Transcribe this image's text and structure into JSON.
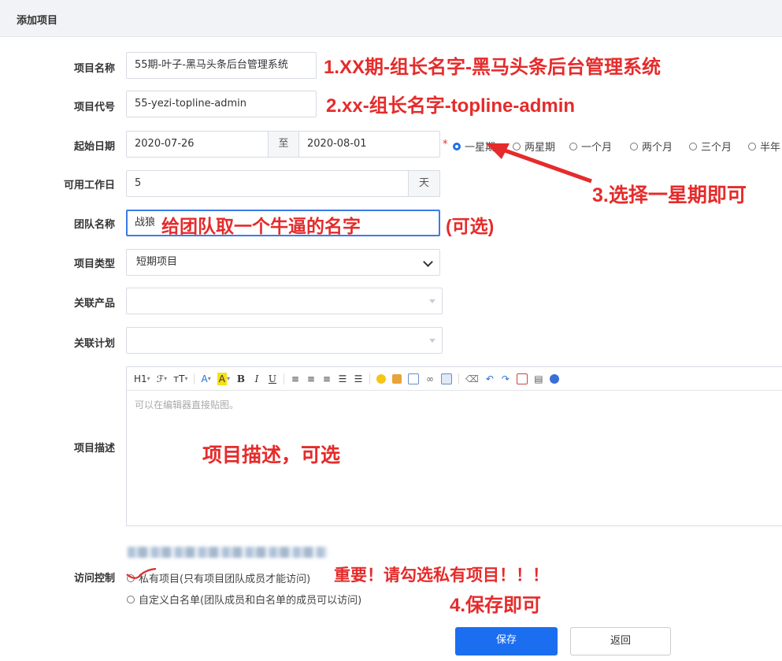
{
  "header": {
    "title": "添加项目"
  },
  "form": {
    "name_label": "项目名称",
    "name_value": "55期-叶子-黑马头条后台管理系统",
    "code_label": "项目代号",
    "code_value": "55-yezi-topline-admin",
    "date_label": "起始日期",
    "start_date": "2020-07-26",
    "to_text": "至",
    "end_date": "2020-08-01",
    "required_mark": "*",
    "durations": [
      "一星期",
      "两星期",
      "一个月",
      "两个月",
      "三个月",
      "半年"
    ],
    "selected_duration": "一星期",
    "workdays_label": "可用工作日",
    "workdays_value": "5",
    "workdays_unit": "天",
    "team_label": "团队名称",
    "team_value": "战狼",
    "type_label": "项目类型",
    "type_value": "短期项目",
    "product_label": "关联产品",
    "plan_label": "关联计划",
    "desc_label": "项目描述",
    "editor_placeholder": "可以在编辑器直接贴图。",
    "access_label": "访问控制",
    "access_options": [
      "私有项目(只有项目团队成员才能访问)",
      "自定义白名单(团队成员和白名单的成员可以访问)"
    ],
    "save_label": "保存",
    "back_label": "返回"
  },
  "toolbar": {
    "heading": "H1",
    "font": "ℱ",
    "size": "тT",
    "font_color": "A",
    "highlight": "A",
    "bold": "B",
    "italic": "I",
    "underline": "U",
    "caret": "▾"
  },
  "annotations": {
    "a1": "1.XX期-组长名字-黑马头条后台管理系统",
    "a2": "2.xx-组长名字-topline-admin",
    "a3": "3.选择一星期即可",
    "a_team": "给团队取一个牛逼的名字",
    "a_team_optional": "(可选)",
    "a_desc": "项目描述，可选",
    "a_important": "重要！请勾选私有项目！！！",
    "a4": "4.保存即可"
  },
  "colors": {
    "primary": "#1b6ef0",
    "annotation": "#e52b2b",
    "header_bg": "#f1f3f6"
  }
}
